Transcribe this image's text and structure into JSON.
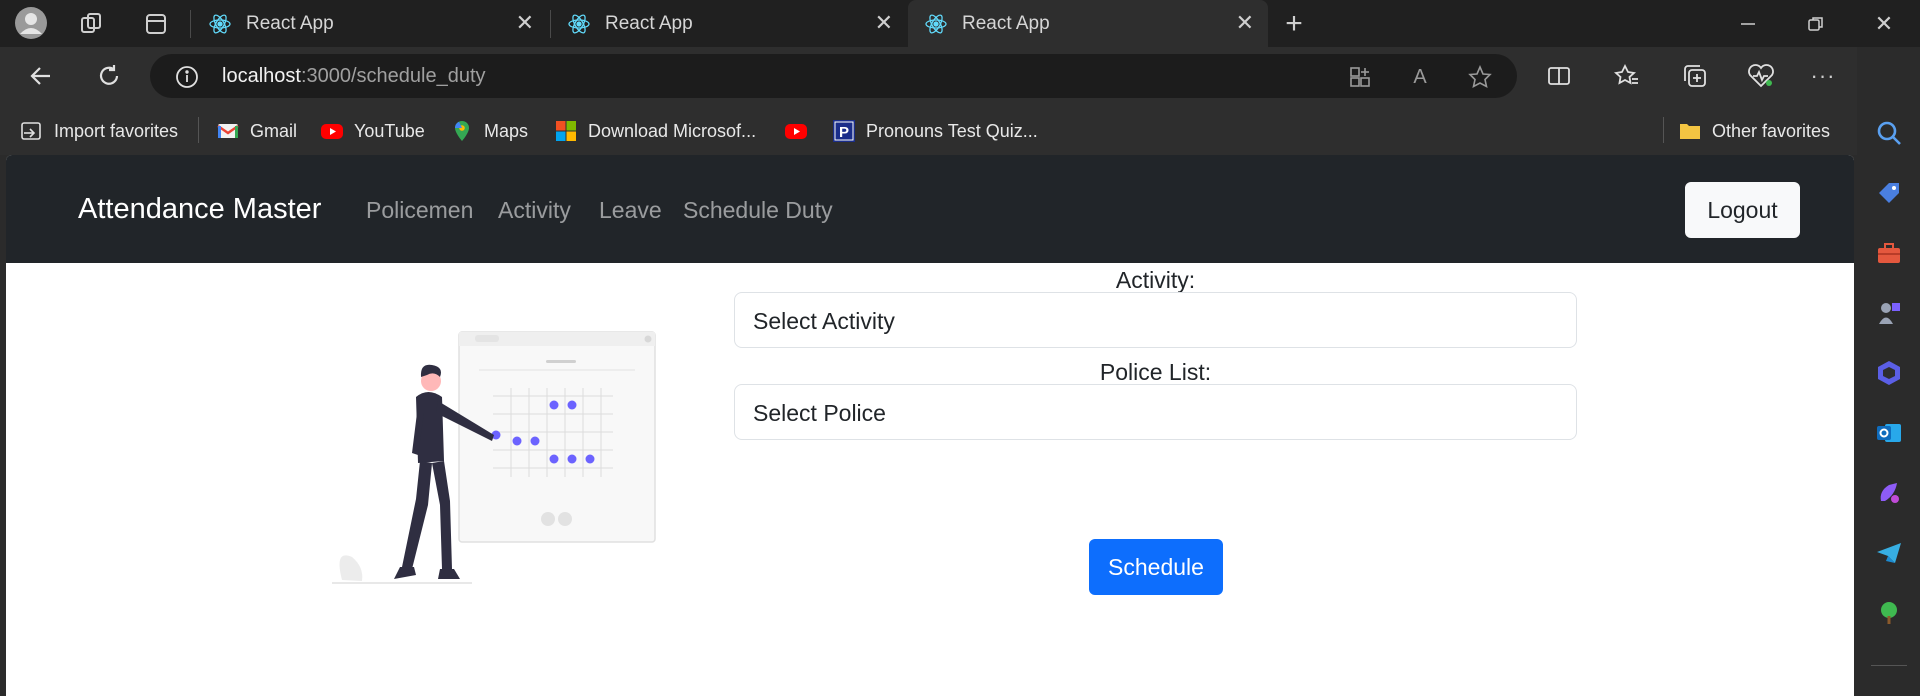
{
  "browser": {
    "tabs": [
      {
        "label": "React App",
        "active": false
      },
      {
        "label": "React App",
        "active": false
      },
      {
        "label": "React App",
        "active": true
      }
    ],
    "url_host": "localhost",
    "url_path": ":3000/schedule_duty",
    "favorites": [
      {
        "label": "Import favorites",
        "icon": "import-icon"
      },
      {
        "label": "Gmail",
        "icon": "gmail-icon"
      },
      {
        "label": "YouTube",
        "icon": "youtube-icon"
      },
      {
        "label": "Maps",
        "icon": "maps-icon"
      },
      {
        "label": "Download Microsof...",
        "icon": "microsoft-icon"
      },
      {
        "label": "",
        "icon": "youtube-icon"
      },
      {
        "label": "Pronouns Test Quiz...",
        "icon": "pronouns-icon"
      }
    ],
    "other_favorites": "Other favorites"
  },
  "app": {
    "brand": "Attendance Master",
    "nav": [
      "Policemen",
      "Activity",
      "Leave",
      "Schedule Duty"
    ],
    "logout": "Logout"
  },
  "form": {
    "activity_label": "Activity:",
    "activity_value": "Select Activity",
    "police_label": "Police List:",
    "police_value": "Select Police",
    "submit": "Schedule"
  },
  "colors": {
    "primary": "#0d6efd",
    "navbar": "#212529",
    "accent_purple": "#6c63ff"
  }
}
